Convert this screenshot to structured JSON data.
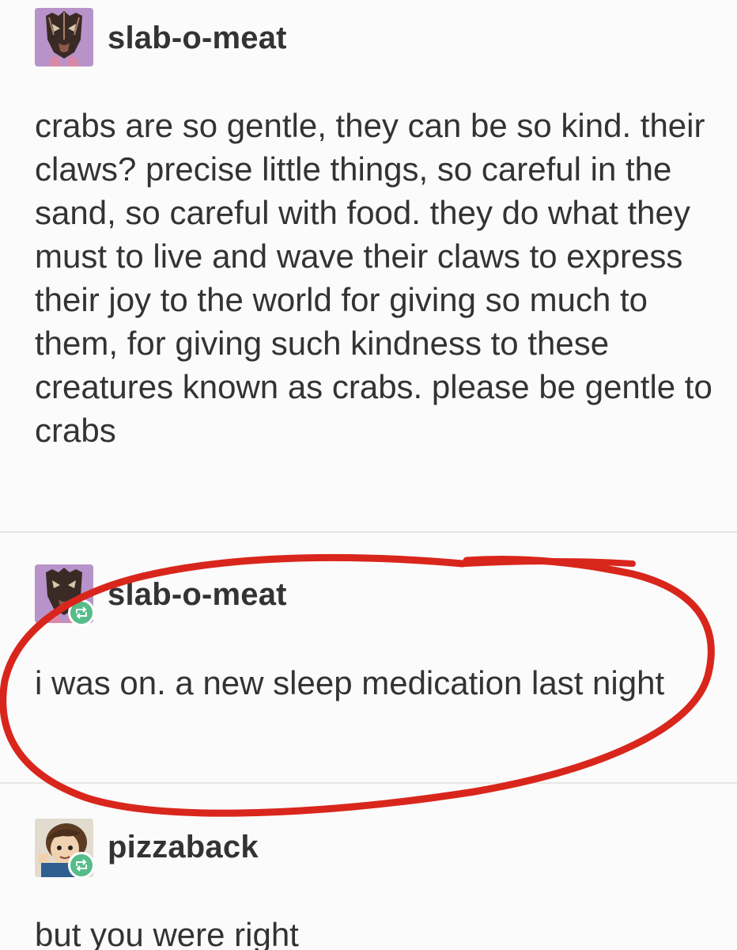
{
  "posts": [
    {
      "username": "slab-o-meat",
      "text": "crabs are so gentle, they can be so kind. their claws? precise little things, so careful in the sand, so careful with food. they do what they must to live and wave their claws to express their joy to the world for giving so much to them, for giving such kindness to these creatures known as crabs. please be gentle to crabs"
    },
    {
      "username": "slab-o-meat",
      "text": "i was on. a new sleep medication last night"
    },
    {
      "username": "pizzaback",
      "text": "but you were right"
    }
  ],
  "colors": {
    "annotation_circle": "#d9261c",
    "reblog_badge": "#56bc8a",
    "text": "#333333"
  },
  "icons": {
    "reblog": "reblog-icon",
    "avatar_mask": "mask-avatar",
    "avatar_cartoon": "cartoon-avatar"
  }
}
